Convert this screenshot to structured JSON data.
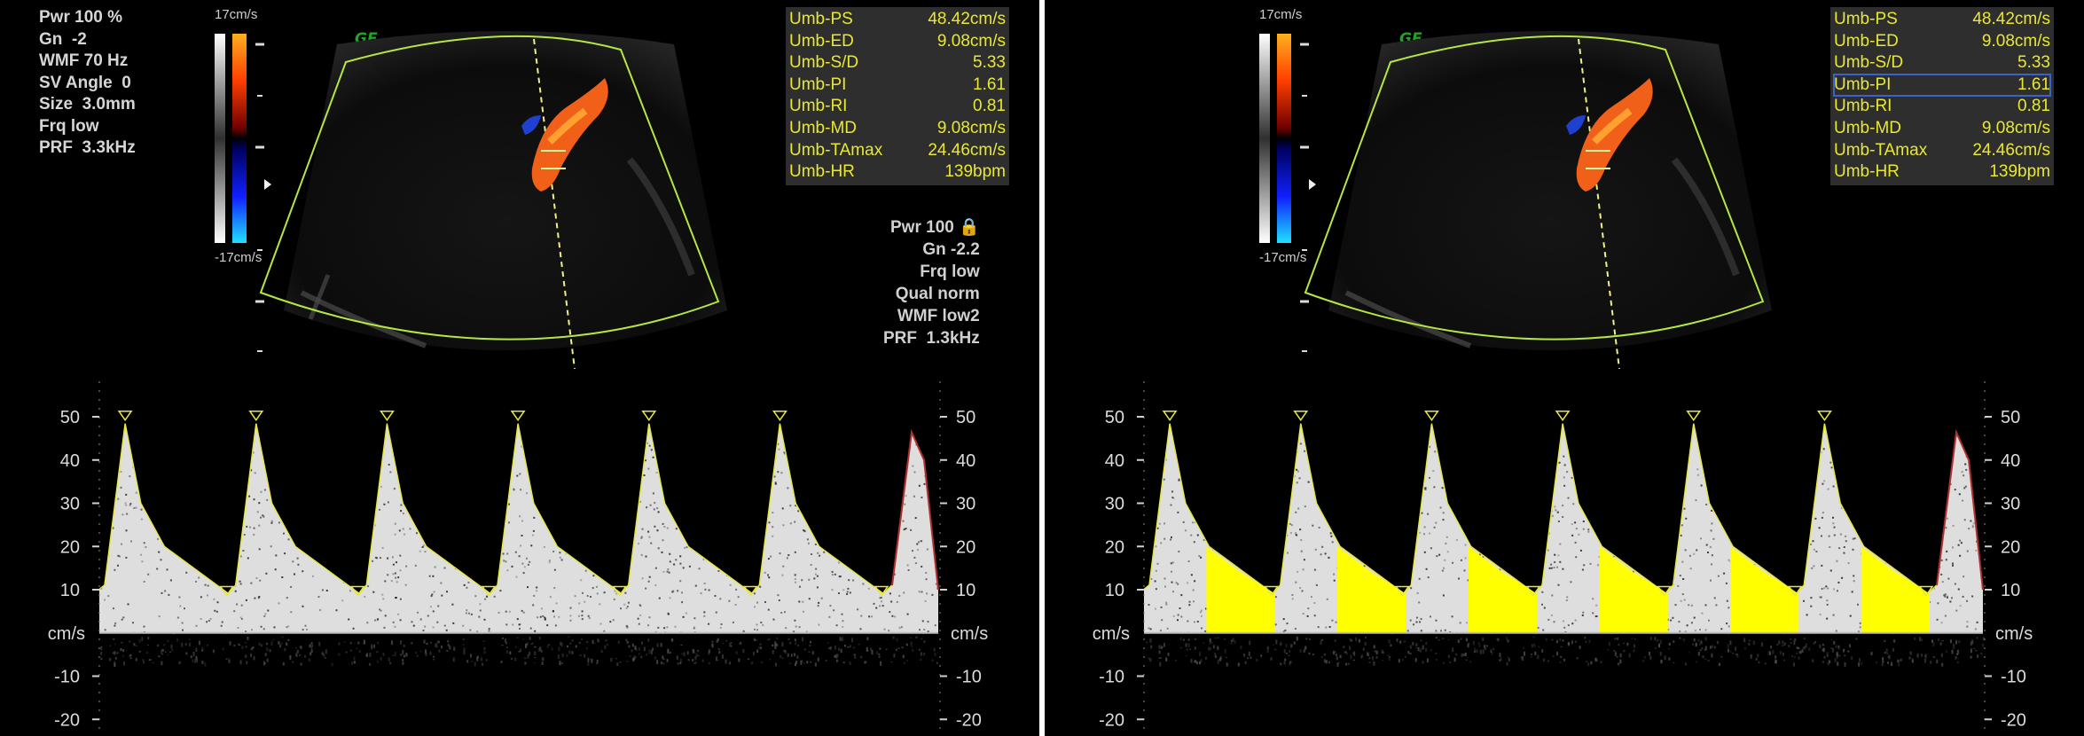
{
  "settings": [
    "Pwr 100 %",
    "Gn  -2",
    "WMF 70 Hz",
    "SV Angle  0",
    "Size  3.0mm",
    "Frq low",
    "PRF  3.3kHz"
  ],
  "color_scale": {
    "top": "17cm/s",
    "bottom": "-17cm/s"
  },
  "logo": "GE",
  "measurements": [
    {
      "label": "Umb-PS",
      "value": "48.42cm/s"
    },
    {
      "label": "Umb-ED",
      "value": "9.08cm/s"
    },
    {
      "label": "Umb-S/D",
      "value": "5.33"
    },
    {
      "label": "Umb-PI",
      "value": "1.61"
    },
    {
      "label": "Umb-RI",
      "value": "0.81"
    },
    {
      "label": "Umb-MD",
      "value": "9.08cm/s"
    },
    {
      "label": "Umb-TAmax",
      "value": "24.46cm/s"
    },
    {
      "label": "Umb-HR",
      "value": "139bpm"
    }
  ],
  "doppler_settings": [
    "Pwr 100 🔒",
    "Gn -2.2",
    "Frq low",
    "Qual norm",
    "WMF low2",
    "PRF  1.3kHz"
  ],
  "axis": {
    "unit": "cm/s",
    "ticks": [
      50,
      40,
      30,
      20,
      10,
      -10,
      -20
    ],
    "range": [
      -22,
      55
    ]
  },
  "spectrum": {
    "peak_velocity": 48.42,
    "end_diastolic_velocity": 9.08,
    "cycles": 6
  },
  "colors": {
    "caliper": "#e6e64a",
    "fill_highlight": "#ffff00",
    "measure_text": "#e8e832",
    "logo": "#1fa51f"
  }
}
